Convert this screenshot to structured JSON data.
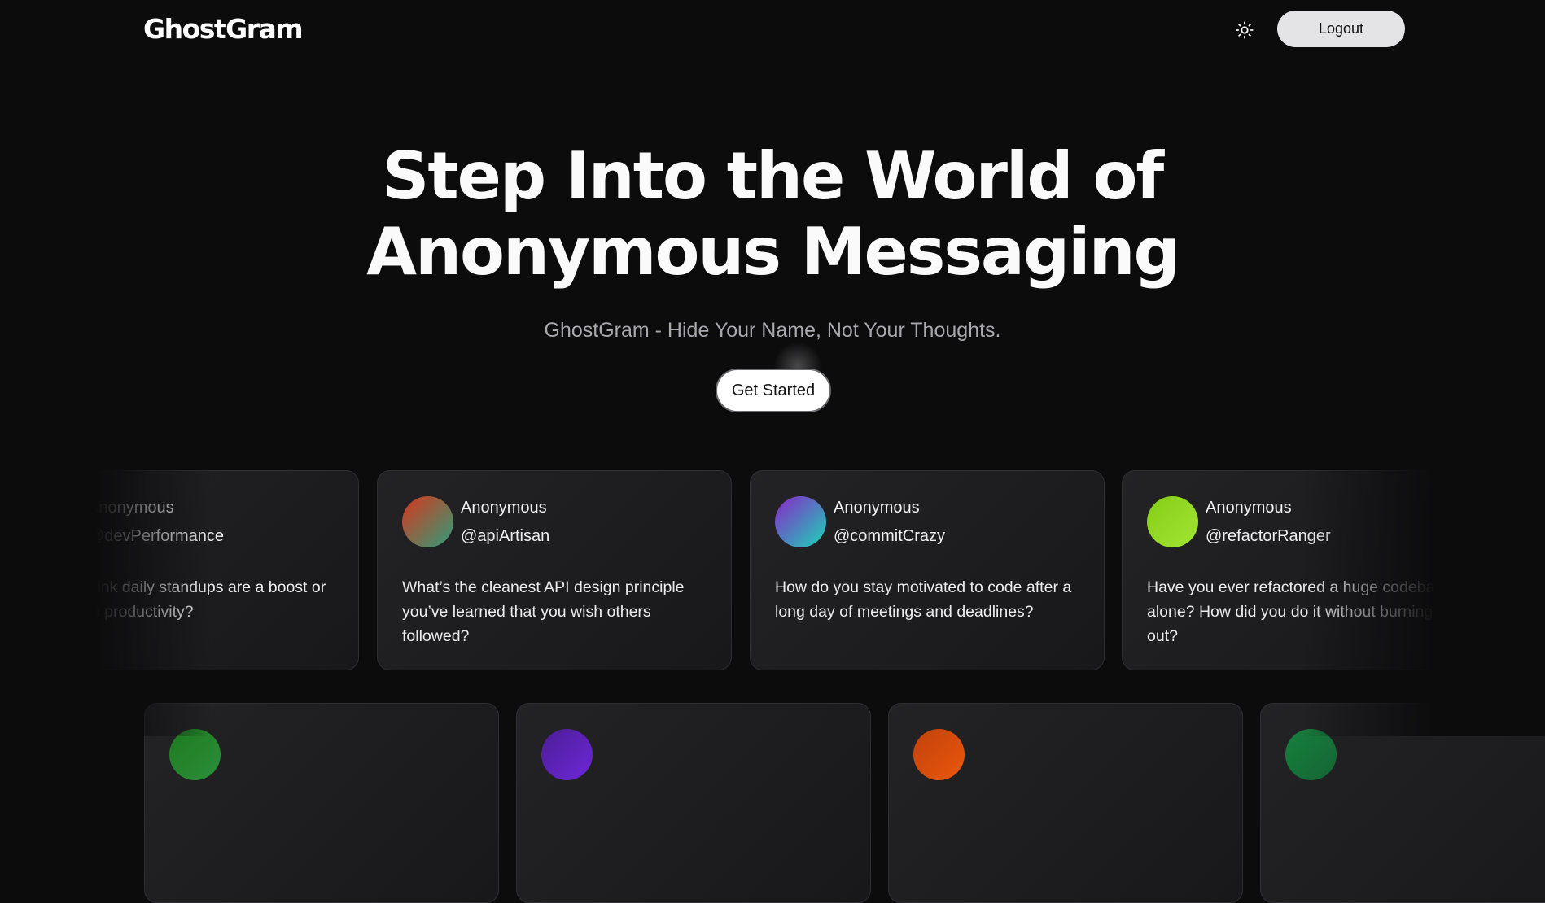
{
  "header": {
    "logo": "GhostGram",
    "theme_toggle_icon": "sun-icon",
    "logout_label": "Logout"
  },
  "hero": {
    "title_line1": "Step Into the World of",
    "title_line2": "Anonymous Messaging",
    "subtitle": "GhostGram - Hide Your Name, Not Your Thoughts.",
    "cta_label": "Get Started"
  },
  "cards_row1": [
    {
      "name": "Anonymous",
      "handle": "@devPerformance",
      "message": "Do you think daily standups are a boost or a drain on productivity?",
      "avatar_colors": [
        "#6b21a8",
        "#4338ca"
      ]
    },
    {
      "name": "Anonymous",
      "handle": "@apiArtisan",
      "message": "What’s the cleanest API design principle you’ve learned that you wish others followed?",
      "avatar_colors": [
        "#d9361b",
        "#2e9e7a"
      ]
    },
    {
      "name": "Anonymous",
      "handle": "@commitCrazy",
      "message": "How do you stay motivated to code after a long day of meetings and deadlines?",
      "avatar_colors": [
        "#8b24c8",
        "#19d6b8"
      ]
    },
    {
      "name": "Anonymous",
      "handle": "@refactorRanger",
      "message": "Have you ever refactored a huge codebase alone? How did you do it without burning out?",
      "avatar_colors": [
        "#84cc16",
        "#a3e635"
      ]
    }
  ],
  "cards_row2_avatar_colors": [
    [
      "#1f7a1f",
      "#2a8f3a"
    ],
    [
      "#4c1d95",
      "#6d28d9"
    ],
    [
      "#c2410c",
      "#ea580c"
    ],
    [
      "#15803d",
      "#166534"
    ]
  ]
}
